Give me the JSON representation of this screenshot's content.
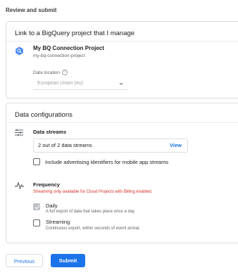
{
  "page": {
    "title": "Review and submit"
  },
  "link_card": {
    "title": "Link to a BigQuery project that I manage",
    "project_name": "My BQ Connection Project",
    "project_id": "my-bq-connection-project",
    "location_label": "Data location",
    "location_help_glyph": "?",
    "location_value": "European Union (eu)"
  },
  "config_card": {
    "title": "Data configurations",
    "streams": {
      "label": "Data streams",
      "summary": "2 out of 2 data streams",
      "view_link": "View",
      "ad_ids_label": "Include advertising identifiers for mobile app streams",
      "ad_ids_checked": false
    },
    "frequency": {
      "label": "Frequency",
      "warning": "Streaming only available for Cloud Projects with Billing enabled.",
      "daily_label": "Daily",
      "daily_desc": "A full export of data that takes place once a day",
      "daily_checked": true,
      "streaming_label": "Streaming",
      "streaming_desc": "Continuous export, within seconds of event arrival.",
      "streaming_checked": false
    }
  },
  "actions": {
    "previous": "Previous",
    "submit": "Submit"
  },
  "colors": {
    "accent": "#1a73e8",
    "warning": "#d93025",
    "border": "#dadce0"
  },
  "icons": {
    "project": "bigquery-icon",
    "streams": "tune-icon",
    "frequency": "pulse-icon",
    "help": "help-icon"
  }
}
